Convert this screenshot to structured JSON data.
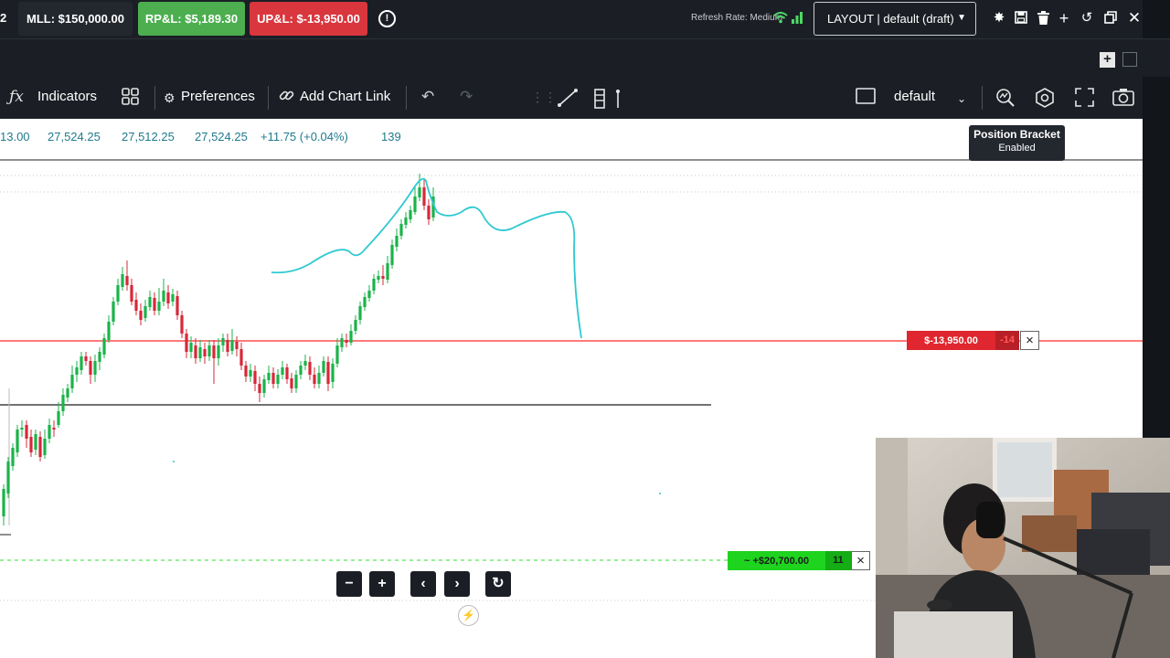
{
  "topbar": {
    "left_mark": "2",
    "mll": "MLL: $150,000.00",
    "rpl": "RP&L: $5,189.30",
    "upl": "UP&L: $-13,950.00",
    "refresh_rate": "Refresh Rate: Medium",
    "layout": "LAYOUT | default (draft)",
    "icons": [
      "settings-icon",
      "save-icon",
      "delete-icon",
      "add-icon",
      "reset-icon",
      "window-icon",
      "close-icon"
    ]
  },
  "toolbar": {
    "indicators": "Indicators",
    "preferences": "Preferences",
    "add_chart_link": "Add Chart Link",
    "template": "default",
    "icons": [
      "function-icon",
      "grid-icon",
      "gear-icon",
      "link-icon",
      "undo-icon",
      "redo-icon",
      "drag-handle-icon",
      "line-tool-icon",
      "order-tool-icon",
      "checkbox-icon",
      "chevron-down-icon",
      "zoom-icon",
      "settings-icon",
      "fullscreen-icon",
      "camera-icon"
    ]
  },
  "quote": {
    "partial": "13.00",
    "high": "27,524.25",
    "low": "27,512.25",
    "close": "27,524.25",
    "change": "+11.75 (+0.04%)",
    "volume": "139"
  },
  "tooltip": {
    "title": "Position Bracket",
    "state": "Enabled"
  },
  "orders": {
    "stop": {
      "amount": "$-13,950.00",
      "qty": "-14"
    },
    "target": {
      "amount": "~ +$20,700.00",
      "qty": "11"
    }
  },
  "chart_data": {
    "type": "candlestick",
    "title": "",
    "series": [],
    "notes": "Price chart with hand-drawn cyan annotation line, red stop line and green dashed target line"
  },
  "colors": {
    "bullish": "#1bb34a",
    "bearish": "#d62839",
    "drawing": "#2fc9d0",
    "stop_line": "#ff2a2a",
    "target_line": "#2fe02f",
    "toolbar_bg": "#1b1f25"
  }
}
